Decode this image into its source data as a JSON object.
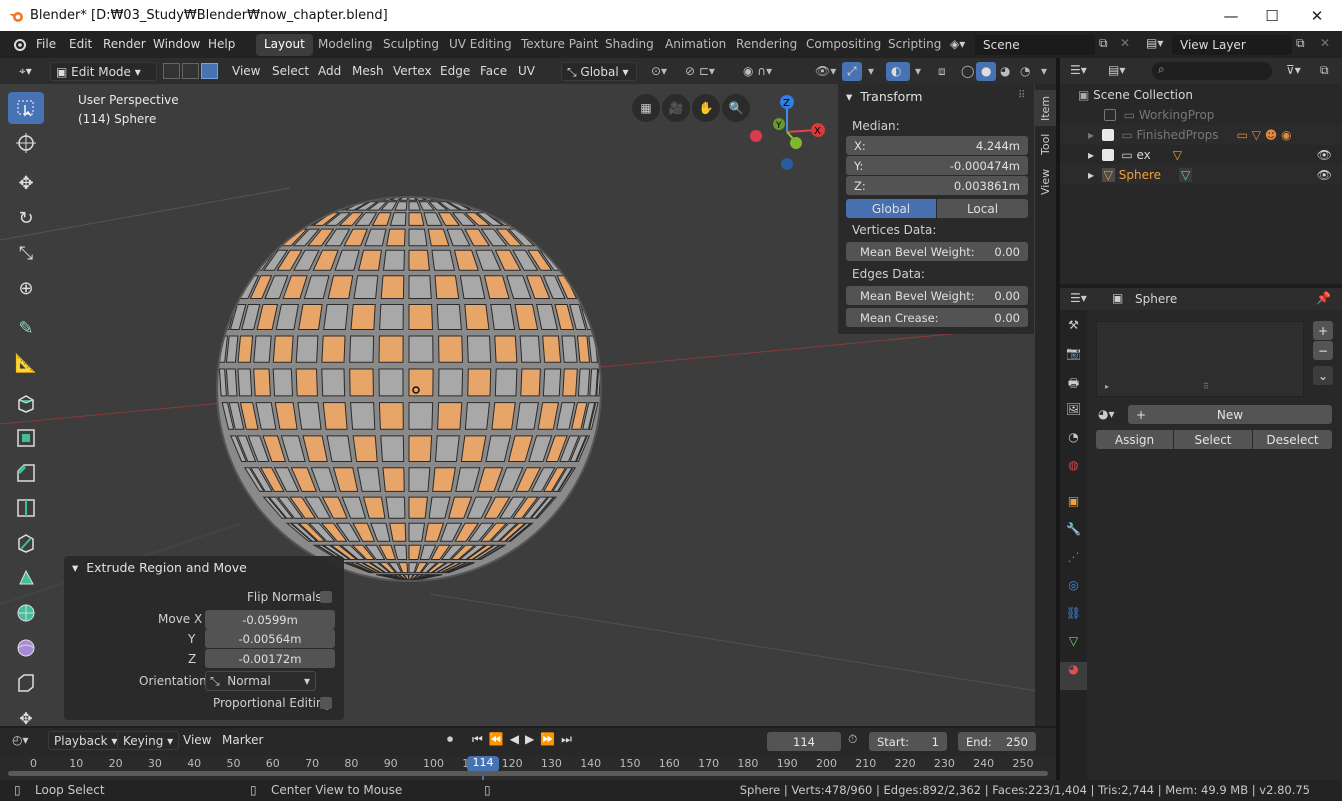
{
  "window": {
    "title": "Blender* [D:₩03_Study₩Blender₩now_chapter.blend]",
    "minimize": "—",
    "maximize": "☐",
    "close": "✕"
  },
  "menubar": {
    "items": [
      "File",
      "Edit",
      "Render",
      "Window",
      "Help"
    ]
  },
  "workspaces": {
    "items": [
      "Layout",
      "Modeling",
      "Sculpting",
      "UV Editing",
      "Texture Paint",
      "Shading",
      "Animation",
      "Rendering",
      "Compositing",
      "Scripting"
    ],
    "active": "Layout"
  },
  "scene": {
    "name": "Scene",
    "view_layer": "View Layer"
  },
  "viewport_header": {
    "mode": "Edit Mode",
    "menus": [
      "View",
      "Select",
      "Add",
      "Mesh",
      "Vertex",
      "Edge",
      "Face",
      "UV"
    ],
    "orientation": "Global"
  },
  "viewport": {
    "view_name": "User Perspective",
    "object_info": "(114) Sphere",
    "axis_labels": {
      "x": "X",
      "y": "Y",
      "z": "Z"
    }
  },
  "npanel": {
    "title": "Transform",
    "median_label": "Median:",
    "x_label": "X:",
    "x": "4.244m",
    "y_label": "Y:",
    "y": "-0.000474m",
    "z_label": "Z:",
    "z": "0.003861m",
    "global": "Global",
    "local": "Local",
    "vertices_label": "Vertices Data:",
    "v_bevel_label": "Mean Bevel Weight:",
    "v_bevel": "0.00",
    "edges_label": "Edges Data:",
    "e_bevel_label": "Mean Bevel Weight:",
    "e_bevel": "0.00",
    "crease_label": "Mean Crease:",
    "crease": "0.00",
    "tabs": [
      "Item",
      "Tool",
      "View"
    ]
  },
  "redo": {
    "title": "Extrude Region and Move",
    "flip_label": "Flip Normals",
    "move_x_label": "Move X",
    "move_x": "-0.0599m",
    "y_label": "Y",
    "y": "-0.00564m",
    "z_label": "Z",
    "z": "-0.00172m",
    "orientation_label": "Orientation",
    "orientation": "Normal",
    "proportional_label": "Proportional Editing"
  },
  "outliner": {
    "items": [
      {
        "name": "Scene Collection"
      },
      {
        "name": "WorkingProp"
      },
      {
        "name": "FinishedProps"
      },
      {
        "name": "ex"
      },
      {
        "name": "Sphere"
      }
    ]
  },
  "properties": {
    "object": "Sphere",
    "new": "New",
    "assign": "Assign",
    "select": "Select",
    "deselect": "Deselect"
  },
  "timeline": {
    "menus": [
      "Playback",
      "Keying",
      "View",
      "Marker"
    ],
    "current_frame": "114",
    "start_label": "Start:",
    "start": "1",
    "end_label": "End:",
    "end": "250",
    "ruler": [
      "0",
      "10",
      "20",
      "30",
      "40",
      "50",
      "60",
      "70",
      "80",
      "90",
      "100",
      "110",
      "120",
      "130",
      "140",
      "150",
      "160",
      "170",
      "180",
      "190",
      "200",
      "210",
      "220",
      "230",
      "240",
      "250"
    ]
  },
  "status": {
    "left": "Loop Select",
    "middle": "Center View to Mouse",
    "stats": "Sphere | Verts:478/960 | Edges:892/2,362 | Faces:223/1,404 | Tris:2,744 | Mem: 49.9 MB | v2.80.75"
  },
  "colors": {
    "accent": "#4772b3",
    "selected_face": "#e8a56a",
    "active_object": "#f0a040"
  }
}
